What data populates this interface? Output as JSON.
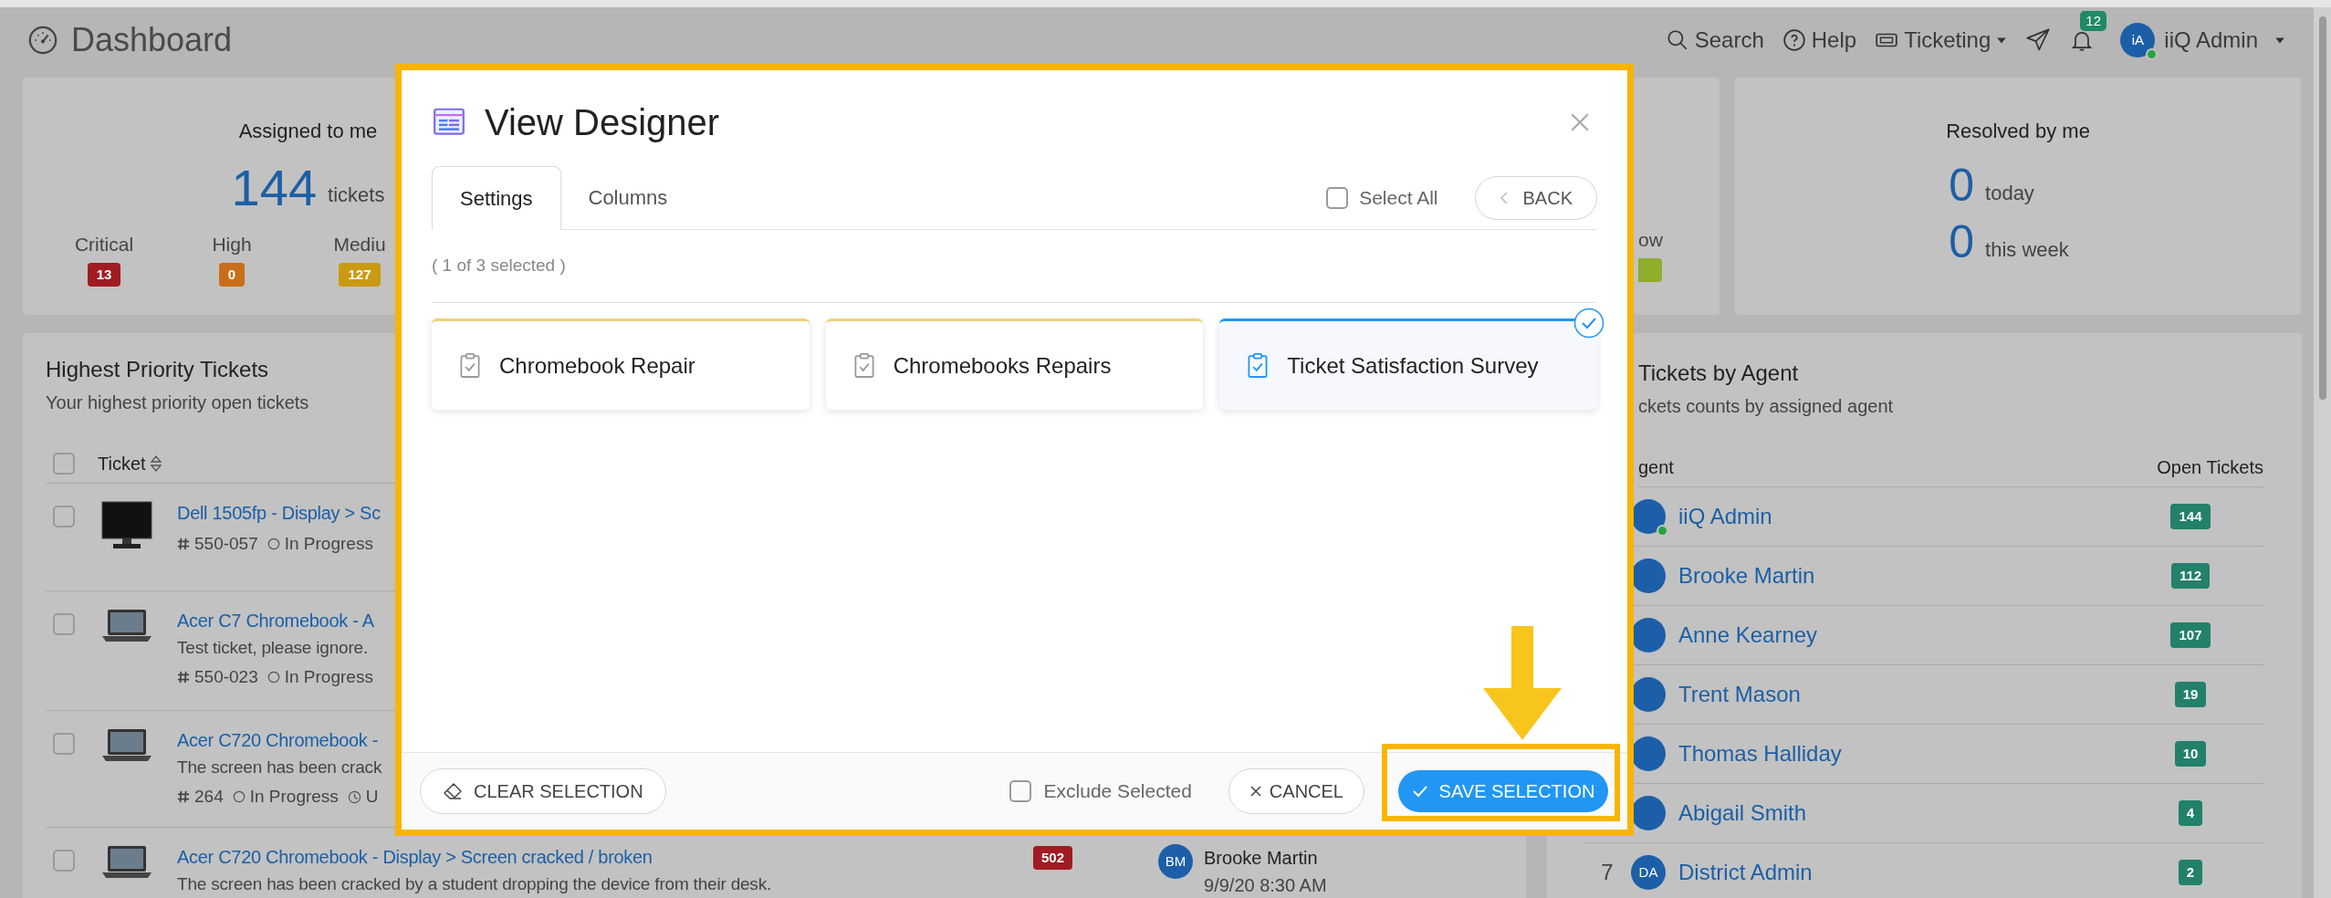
{
  "header": {
    "title": "Dashboard",
    "nav": [
      {
        "kind": "search",
        "label": "Search"
      },
      {
        "kind": "help",
        "label": "Help"
      },
      {
        "kind": "menu",
        "label": "Ticketing"
      },
      {
        "kind": "send"
      },
      {
        "kind": "notifications",
        "badge": "12"
      }
    ],
    "user": {
      "initials": "iA",
      "name": "iiQ Admin",
      "online": true
    }
  },
  "stats": [
    {
      "kind": "assigned",
      "title": "Assigned to me",
      "total": "144",
      "unit": "tickets",
      "priorities": [
        {
          "label": "Critical",
          "count": "13",
          "color": "#a01c22"
        },
        {
          "label": "High",
          "count": "0",
          "color": "#c86e19"
        },
        {
          "label": "Mediu",
          "count": "127",
          "color": "#c99a12"
        }
      ]
    },
    {
      "kind": "partial",
      "priorities": [
        {
          "label": "ow",
          "color": "#8fae2c"
        }
      ]
    },
    {
      "kind": "resolved",
      "title": "Resolved by me",
      "lines": [
        {
          "value": "0",
          "unit": "today"
        },
        {
          "value": "0",
          "unit": "this week"
        }
      ]
    }
  ],
  "tickets_panel": {
    "title": "Highest Priority Tickets",
    "subtitle": "Your highest priority open tickets",
    "select_all": {
      "checked": false
    },
    "columns": [
      "Ticket"
    ],
    "rows": [
      {
        "kind": "monitor",
        "checked": false,
        "title": "Dell 1505fp - Display > Sc",
        "number": "550-057",
        "status": "In Progress"
      },
      {
        "kind": "laptop",
        "checked": false,
        "title": "Acer C7 Chromebook - A",
        "description": "Test ticket, please ignore.",
        "number": "550-023",
        "status": "In Progress"
      },
      {
        "kind": "laptop",
        "checked": false,
        "title": "Acer C720 Chromebook -",
        "description": "The screen has been crack",
        "number": "264",
        "status": "In Progress",
        "due": "U"
      },
      {
        "kind": "laptop",
        "checked": false,
        "title": "Acer C720 Chromebook - Display > Screen cracked / broken",
        "description": "The screen has been cracked by a student dropping the device from their desk.",
        "priority": {
          "label": "502",
          "color": "#a01c22"
        },
        "assignee": {
          "initials": "BM",
          "name": "Brooke Martin",
          "date": "9/9/20 8:30 AM"
        }
      }
    ]
  },
  "agents_panel": {
    "title": "Tickets by Agent",
    "subtitle": "ckets counts by assigned agent",
    "columns": [
      "gent",
      "Open Tickets"
    ],
    "rows": [
      {
        "name": "iiQ Admin",
        "count": "144",
        "online": true
      },
      {
        "name": "Brooke Martin",
        "count": "112",
        "online": false
      },
      {
        "name": "Anne Kearney",
        "count": "107",
        "online": false
      },
      {
        "name": "Trent Mason",
        "count": "19",
        "online": false
      },
      {
        "name": "Thomas Halliday",
        "count": "10",
        "online": false
      },
      {
        "name": "Abigail Smith",
        "count": "4",
        "online": false
      },
      {
        "rank": "7",
        "initials": "DA",
        "name": "District Admin",
        "count": "2",
        "online": false
      }
    ]
  },
  "modal": {
    "title": "View Designer",
    "tabs": [
      {
        "label": "Settings",
        "selected": true
      },
      {
        "label": "Columns",
        "selected": false
      }
    ],
    "select_all": {
      "label": "Select All",
      "checked": false
    },
    "back": "BACK",
    "selection_info": "( 1 of 3 selected )",
    "cards": [
      {
        "label": "Chromebook Repair",
        "selected": false
      },
      {
        "label": "Chromebooks Repairs",
        "selected": false
      },
      {
        "label": "Ticket Satisfaction Survey",
        "selected": true
      }
    ],
    "footer": {
      "clear": "CLEAR SELECTION",
      "exclude": {
        "label": "Exclude Selected",
        "checked": false
      },
      "cancel": "CANCEL",
      "save": "SAVE SELECTION"
    }
  }
}
